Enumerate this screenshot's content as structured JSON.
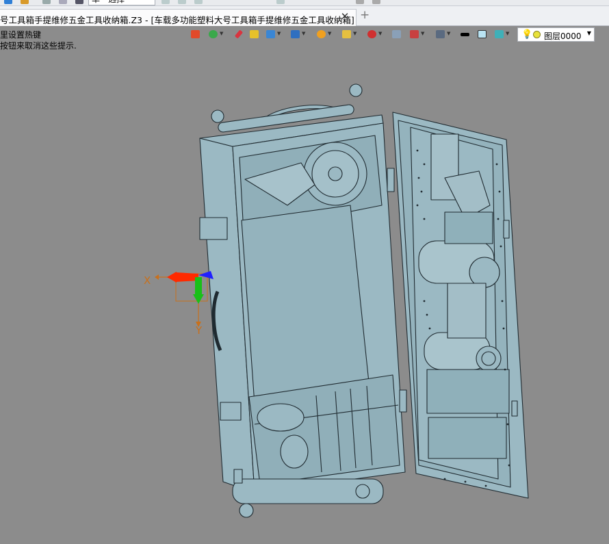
{
  "top_toolbar": {
    "select_mode": "单一选择"
  },
  "tab": {
    "title": "号工具箱手提维修五金工具收纳箱.Z3 - [车载多功能塑料大号工具箱手提维修五金工具收纳箱]",
    "close_glyph": "✕",
    "add_glyph": "+"
  },
  "hints": {
    "line1": "里设置热键",
    "line2": "按钮来取消这些提示."
  },
  "view_toolbar": {
    "icons": [
      "view-orient-icon",
      "render-mode-icon",
      "pen-icon",
      "shaded-box-icon",
      "cube-view-icon",
      "cube-blue-icon",
      "section-icon",
      "zoom-fit-icon",
      "triad-icon",
      "panel-icon",
      "frame-icon",
      "monitor-icon",
      "color-swatch-icon",
      "fill-color-icon",
      "layer-stack-icon"
    ]
  },
  "layer": {
    "name": "图层0000",
    "dropdown_glyph": "▼"
  },
  "colors": {
    "viewport_bg": "#8c8c8c",
    "model_face": "#9bb9c3",
    "model_line": "#1f2a30",
    "axis_x": "#ff2a00",
    "axis_y": "#18c018",
    "axis_z": "#2020ff",
    "axis_label": "#c8701c"
  },
  "triad": {
    "x_label": "X",
    "y_label": "Y"
  }
}
